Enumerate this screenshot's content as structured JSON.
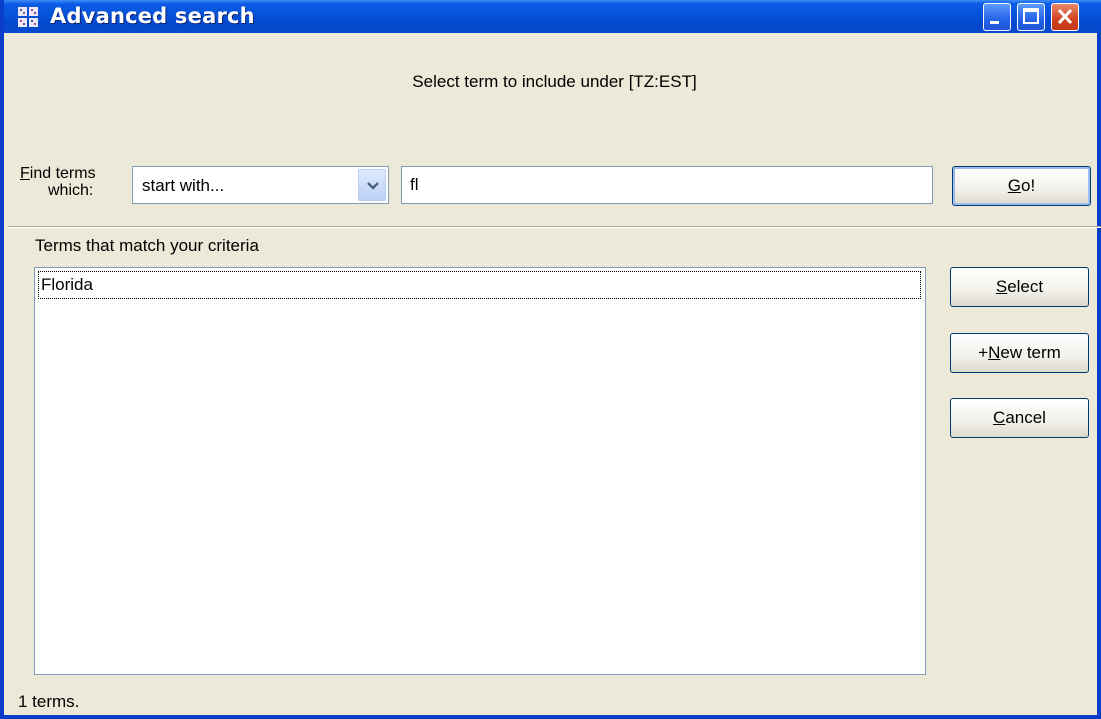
{
  "window": {
    "title": "Advanced search",
    "app_icon": "grid-app-icon",
    "controls": [
      "minimize-icon",
      "maximize-icon",
      "close-icon"
    ],
    "accent": "#0A3EC8"
  },
  "heading": "Select term to include under [TZ:EST]",
  "find": {
    "label_line1_rest": "ind terms",
    "label_line1_accel": "F",
    "label_line2": "which:",
    "mode_value": "start with...",
    "query_value": "fl"
  },
  "buttons": {
    "go": {
      "accel": "G",
      "rest": "o!"
    },
    "select": {
      "accel": "S",
      "rest": "elect"
    },
    "new_term": {
      "pre": "+",
      "accel": "N",
      "rest": "ew term"
    },
    "cancel": {
      "accel": "C",
      "rest": "ancel"
    }
  },
  "results": {
    "label": "Terms that match your criteria",
    "items": [
      "Florida"
    ]
  },
  "status": "1 terms."
}
